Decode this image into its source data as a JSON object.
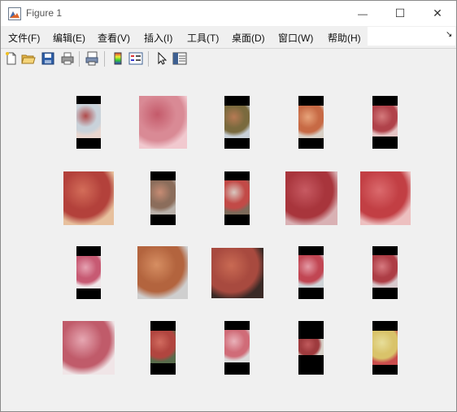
{
  "window": {
    "title": "Figure 1",
    "app_icon": "matlab-figure-icon"
  },
  "controls": {
    "minimize": "—",
    "maximize": "☐",
    "close": "✕"
  },
  "menu": [
    {
      "label": "文件(F)"
    },
    {
      "label": "编辑(E)"
    },
    {
      "label": "查看(V)"
    },
    {
      "label": "插入(I)"
    },
    {
      "label": "工具(T)"
    },
    {
      "label": "桌面(D)"
    },
    {
      "label": "窗口(W)"
    },
    {
      "label": "帮助(H)"
    }
  ],
  "menu_dock_arrow": "↘",
  "toolbar": [
    "new-figure-icon",
    "open-file-icon",
    "save-icon",
    "print-icon",
    "print-preview-icon",
    "colorbar-icon",
    "legend-icon",
    "pointer-icon",
    "property-inspector-icon"
  ],
  "images": [
    {
      "name": "apple-1",
      "colors": [
        "#c9d2da",
        "#b04a4a",
        "#e9d6cf"
      ]
    },
    {
      "name": "apple-2",
      "colors": [
        "#d98a95",
        "#c45a6a",
        "#f1c9cf"
      ]
    },
    {
      "name": "apple-3",
      "colors": [
        "#7a6a3e",
        "#b77a54",
        "#c8d0d8"
      ]
    },
    {
      "name": "apple-4",
      "colors": [
        "#c76a45",
        "#e7a37a",
        "#d9d0c6"
      ]
    },
    {
      "name": "apple-5",
      "colors": [
        "#b0424a",
        "#d47a7c",
        "#e5c5c5"
      ]
    },
    {
      "name": "apple-6",
      "colors": [
        "#b3413b",
        "#d36d59",
        "#e7c09d"
      ]
    },
    {
      "name": "apple-7",
      "colors": [
        "#8b6d5b",
        "#c78c74",
        "#b9b1aa"
      ]
    },
    {
      "name": "apple-8",
      "colors": [
        "#c24a47",
        "#d9c8c0",
        "#7c6a5a"
      ]
    },
    {
      "name": "apple-9",
      "colors": [
        "#a8353c",
        "#c75a62",
        "#d9b1b4"
      ]
    },
    {
      "name": "apple-10",
      "colors": [
        "#c23f44",
        "#db6a6d",
        "#edc0c0"
      ]
    },
    {
      "name": "apple-11",
      "colors": [
        "#c75a73",
        "#e6a2b2",
        "#f0e6e9"
      ]
    },
    {
      "name": "apple-12",
      "colors": [
        "#b3643e",
        "#d68e62",
        "#cfcfcf"
      ]
    },
    {
      "name": "apple-13",
      "colors": [
        "#a84a3f",
        "#c96a53",
        "#3a2a26"
      ]
    },
    {
      "name": "apple-14",
      "colors": [
        "#c14653",
        "#e49aa5",
        "#cfd4d8"
      ]
    },
    {
      "name": "apple-15",
      "colors": [
        "#ad3d45",
        "#d77a80",
        "#d8c9cd"
      ]
    },
    {
      "name": "apple-16",
      "colors": [
        "#c05b6a",
        "#e6a7b2",
        "#f0e5e7"
      ]
    },
    {
      "name": "apple-17",
      "colors": [
        "#b1453f",
        "#d16b5f",
        "#586b4b"
      ]
    },
    {
      "name": "apple-18",
      "colors": [
        "#d06c78",
        "#e9b2ba",
        "#dcdcdc"
      ]
    },
    {
      "name": "apple-19",
      "colors": [
        "#9e3b3e",
        "#c05a5c",
        "#d7d0c8"
      ]
    },
    {
      "name": "apple-20",
      "colors": [
        "#d9c36a",
        "#e7de9a",
        "#c94c4c"
      ]
    }
  ]
}
